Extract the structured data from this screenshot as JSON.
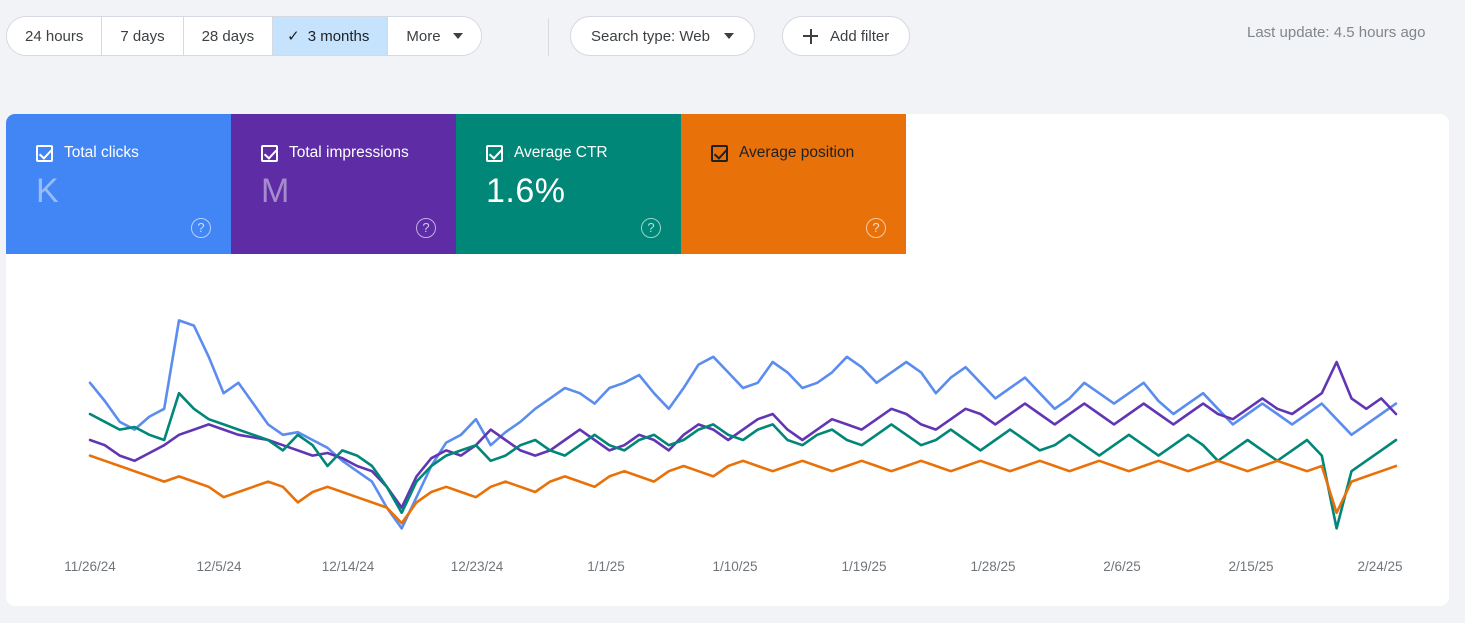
{
  "toolbar": {
    "date_range": {
      "options": [
        {
          "label": "24 hours",
          "active": false
        },
        {
          "label": "7 days",
          "active": false
        },
        {
          "label": "28 days",
          "active": false
        },
        {
          "label": "3 months",
          "active": true
        },
        {
          "label": "More",
          "active": false
        }
      ]
    },
    "search_type_label": "Search type: Web",
    "add_filter_label": "Add filter",
    "last_update": "Last update: 4.5 hours ago"
  },
  "cards": [
    {
      "label": "Total clicks",
      "value": "K",
      "color": "#4285f4",
      "masked": true,
      "dark": false,
      "checked": true,
      "help": "?"
    },
    {
      "label": "Total impressions",
      "value": "M",
      "color": "#5e2ca5",
      "masked": true,
      "dark": false,
      "checked": true,
      "help": "?"
    },
    {
      "label": "Average CTR",
      "value": "1.6%",
      "color": "#008778",
      "masked": false,
      "dark": false,
      "checked": true,
      "help": "?"
    },
    {
      "label": "Average position",
      "value": "",
      "color": "#e8710a",
      "masked": false,
      "dark": true,
      "checked": true,
      "help": "?"
    }
  ],
  "chart_data": {
    "type": "line",
    "title": "",
    "xlabel": "",
    "ylabel": "",
    "grid": false,
    "legend": "metric-cards-above",
    "x_tick_labels": [
      "11/26/24",
      "12/5/24",
      "12/14/24",
      "12/23/24",
      "1/1/25",
      "1/10/25",
      "1/19/25",
      "1/28/25",
      "2/6/25",
      "2/15/25",
      "2/24/25"
    ],
    "x_tick_positions": [
      84,
      213,
      342,
      471,
      600,
      729,
      858,
      987,
      1116,
      1245,
      1374
    ],
    "series": [
      {
        "name": "Total clicks",
        "color": "#5b8def",
        "values": [
          62,
          55,
          47,
          44,
          49,
          52,
          86,
          84,
          72,
          58,
          62,
          54,
          46,
          42,
          43,
          40,
          37,
          32,
          28,
          24,
          14,
          6,
          18,
          30,
          39,
          42,
          48,
          38,
          43,
          47,
          52,
          56,
          60,
          58,
          54,
          60,
          62,
          65,
          58,
          52,
          60,
          69,
          72,
          66,
          60,
          62,
          70,
          66,
          60,
          62,
          66,
          72,
          68,
          62,
          66,
          70,
          66,
          58,
          64,
          68,
          62,
          56,
          60,
          64,
          58,
          52,
          56,
          62,
          58,
          54,
          58,
          62,
          55,
          50,
          54,
          58,
          52,
          46,
          50,
          54,
          50,
          46,
          50,
          54,
          48,
          42,
          46,
          50,
          54
        ]
      },
      {
        "name": "Total impressions",
        "color": "#6236b3",
        "values": [
          40,
          38,
          34,
          32,
          35,
          38,
          42,
          44,
          46,
          44,
          42,
          41,
          40,
          38,
          36,
          34,
          35,
          33,
          30,
          28,
          22,
          14,
          26,
          33,
          36,
          34,
          38,
          44,
          40,
          36,
          34,
          36,
          40,
          44,
          40,
          36,
          38,
          42,
          40,
          36,
          42,
          46,
          44,
          40,
          44,
          48,
          50,
          44,
          40,
          44,
          48,
          46,
          44,
          48,
          52,
          50,
          46,
          44,
          48,
          52,
          50,
          46,
          50,
          54,
          50,
          46,
          50,
          54,
          50,
          46,
          50,
          54,
          50,
          46,
          50,
          54,
          50,
          48,
          52,
          56,
          52,
          50,
          54,
          58,
          70,
          56,
          52,
          56,
          50
        ]
      },
      {
        "name": "Average CTR",
        "color": "#008778",
        "values": [
          50,
          47,
          44,
          45,
          42,
          40,
          58,
          52,
          48,
          46,
          44,
          42,
          40,
          36,
          42,
          38,
          30,
          36,
          34,
          30,
          22,
          12,
          24,
          30,
          34,
          36,
          38,
          32,
          34,
          38,
          40,
          36,
          34,
          38,
          42,
          38,
          36,
          40,
          42,
          38,
          40,
          44,
          46,
          42,
          40,
          44,
          46,
          40,
          38,
          42,
          44,
          40,
          38,
          42,
          46,
          42,
          38,
          40,
          44,
          40,
          36,
          40,
          44,
          40,
          36,
          38,
          42,
          38,
          34,
          38,
          42,
          38,
          34,
          38,
          42,
          38,
          32,
          36,
          40,
          36,
          32,
          36,
          40,
          34,
          6,
          28,
          32,
          36,
          40
        ]
      },
      {
        "name": "Average position",
        "color": "#e8710a",
        "values": [
          34,
          32,
          30,
          28,
          26,
          24,
          26,
          24,
          22,
          18,
          20,
          22,
          24,
          22,
          16,
          20,
          22,
          20,
          18,
          16,
          14,
          8,
          16,
          20,
          22,
          20,
          18,
          22,
          24,
          22,
          20,
          24,
          26,
          24,
          22,
          26,
          28,
          26,
          24,
          28,
          30,
          28,
          26,
          30,
          32,
          30,
          28,
          30,
          32,
          30,
          28,
          30,
          32,
          30,
          28,
          30,
          32,
          30,
          28,
          30,
          32,
          30,
          28,
          30,
          32,
          30,
          28,
          30,
          32,
          30,
          28,
          30,
          32,
          30,
          28,
          30,
          32,
          30,
          28,
          30,
          32,
          30,
          28,
          30,
          12,
          24,
          26,
          28,
          30
        ]
      }
    ],
    "y_baseline_note": "y-values are relative plot heights (no axis labels rendered)"
  }
}
